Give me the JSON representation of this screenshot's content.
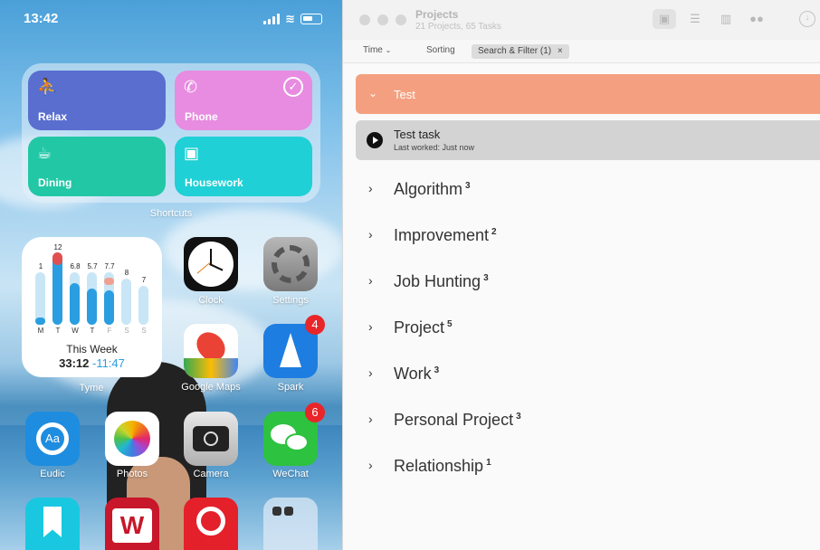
{
  "phone": {
    "status": {
      "time": "13:42"
    },
    "shortcuts": {
      "caption": "Shortcuts",
      "items": [
        {
          "label": "Relax",
          "icon": "figure-icon",
          "color": "#5a6ed0"
        },
        {
          "label": "Phone",
          "icon": "phone-icon",
          "color": "#e78ce0"
        },
        {
          "label": "Dining",
          "icon": "dining-icon",
          "color": "#22c7a6"
        },
        {
          "label": "Housework",
          "icon": "washer-icon",
          "color": "#1fd0d6"
        }
      ]
    },
    "tyme_widget": {
      "caption": "Tyme",
      "days": [
        "M",
        "T",
        "W",
        "T",
        "F",
        "S",
        "S"
      ],
      "values": [
        "1",
        "12",
        "6.8",
        "5.7",
        "7.7",
        "8",
        "7"
      ],
      "week_label": "This Week",
      "total": "33:12",
      "delta": "-11:47"
    },
    "apps": [
      {
        "label": "Clock",
        "badge": ""
      },
      {
        "label": "Settings",
        "badge": ""
      },
      {
        "label": "Google Maps",
        "badge": ""
      },
      {
        "label": "Spark",
        "badge": "4"
      },
      {
        "label": "Eudic",
        "badge": ""
      },
      {
        "label": "Photos",
        "badge": ""
      },
      {
        "label": "Camera",
        "badge": ""
      },
      {
        "label": "WeChat",
        "badge": "6"
      }
    ]
  },
  "window": {
    "title": "Projects",
    "subtitle": "21 Projects, 65 Tasks",
    "toolbar": {
      "time": "Time",
      "sorting": "Sorting",
      "filter_chip": "Search & Filter (1)",
      "chip_close": "×"
    },
    "group": {
      "name": "Test",
      "color": "#f4a080"
    },
    "task": {
      "name": "Test task",
      "last_worked": "Last worked: Just now"
    },
    "projects": [
      {
        "name": "Algorithm",
        "count": "3"
      },
      {
        "name": "Improvement",
        "count": "2"
      },
      {
        "name": "Job Hunting",
        "count": "3"
      },
      {
        "name": "Project",
        "count": "5"
      },
      {
        "name": "Work",
        "count": "3"
      },
      {
        "name": "Personal Project",
        "count": "3"
      },
      {
        "name": "Relationship",
        "count": "1"
      }
    ]
  }
}
